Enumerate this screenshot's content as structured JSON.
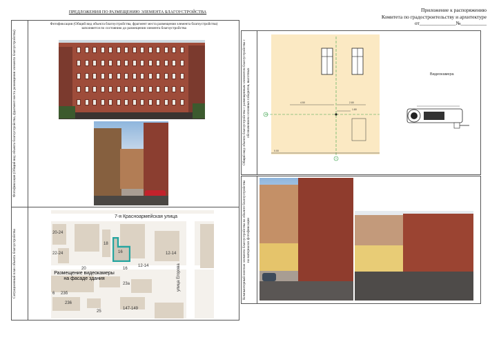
{
  "doc": {
    "left_title": "ПРЕДЛОЖЕНИЯ ПО РАЗМЕЩЕНИЮ ЭЛЕМЕНТА БЛАГОУСТРОЙСТВА",
    "appendix_line1": "Приложение к распоряжению",
    "appendix_line2": "Комитета по градостроительству и архитектуре",
    "appendix_line3": "от______________№__________"
  },
  "left_panel": {
    "photo_label": "Фотофиксация (Общий вид объекта благоустройства, фрагмент места размещения элемента благоустройства)",
    "photo_caption_line1": "Фотофиксация (Общий вид объекта благоустройства, фрагмент места размещения элемента благоустройства)",
    "photo_caption_line2": "заполняется по состоянию до размещения элемента благоустройства",
    "situation_label": "Ситуационный план объекта благоустройства"
  },
  "map": {
    "street": "7-я Красноармейская улица",
    "street_side": "улица Егорова",
    "placement_note_line1": "Размещение видеокамеры",
    "placement_note_line2": "на фасаде здания",
    "building_numbers": [
      "20-24",
      "22-24",
      "18",
      "16",
      "12-14",
      "16",
      "12-14",
      "20",
      "23а",
      "23б",
      "236",
      "25",
      "147-149",
      "6"
    ]
  },
  "right_top": {
    "label": "Общий вид объекта благоустройства с размещенным элементом благоустройства с обозначением основных габаритов, высотных",
    "camera_label": "Видеокамера",
    "dims": [
      "4.50",
      "2.80",
      "1.80",
      "0.00"
    ],
    "axis_marks": [
      "А",
      "1"
    ]
  },
  "right_bottom": {
    "label": "Компьютерный монтаж элемента благоустройства на объекте благоустройства на материалах фотофиксации"
  },
  "colors": {
    "brick": "#9e4c3a",
    "highlight": "#25a5a0",
    "wall": "#fbe9c3"
  }
}
